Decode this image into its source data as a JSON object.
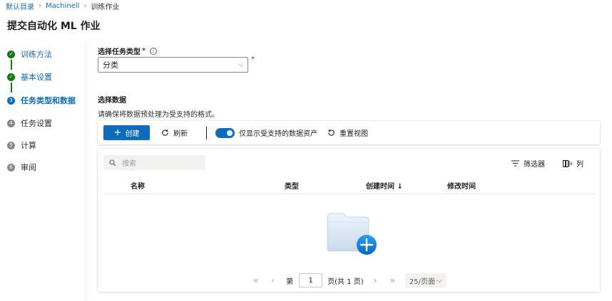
{
  "breadcrumb": {
    "root": "默认目录",
    "workspace": "Machinell",
    "current": "训练作业"
  },
  "page": {
    "title": "提交自动化 ML 作业"
  },
  "steps": [
    {
      "number": "✓",
      "label": "训练方法",
      "state": "done"
    },
    {
      "number": "✓",
      "label": "基本设置",
      "state": "done"
    },
    {
      "number": "3",
      "label": "任务类型和数据",
      "state": "current"
    },
    {
      "number": "4",
      "label": "任务设置",
      "state": "pending"
    },
    {
      "number": "5",
      "label": "计算",
      "state": "pending"
    },
    {
      "number": "6",
      "label": "审阅",
      "state": "pending"
    }
  ],
  "task_type": {
    "label": "选择任务类型",
    "required_mark": "*",
    "info": "i",
    "value": "分类",
    "chevron": "⌵"
  },
  "data_section": {
    "title": "选择数据",
    "description": "请确保将数据预处理为受支持的格式。"
  },
  "toolbar": {
    "create": "创建",
    "create_icon": "+",
    "refresh": "刷新",
    "toggle_label": "仅显示受支持的数据资产",
    "reset_view": "重置视图"
  },
  "grid": {
    "search_placeholder": "搜索",
    "filter": "筛选器",
    "columns_button": "列",
    "columns": [
      "名称",
      "类型",
      "创建时间 ↓",
      "修改时间"
    ]
  },
  "pager": {
    "first": "«",
    "prev": "‹",
    "page_prefix": "第",
    "page": "1",
    "page_suffix": "页(共 1 页)",
    "next": "›",
    "last": "»",
    "per_page": "25/页面"
  },
  "colors": {
    "accent": "#0f6cbd",
    "success": "#107c10",
    "required": "#a4262c"
  }
}
